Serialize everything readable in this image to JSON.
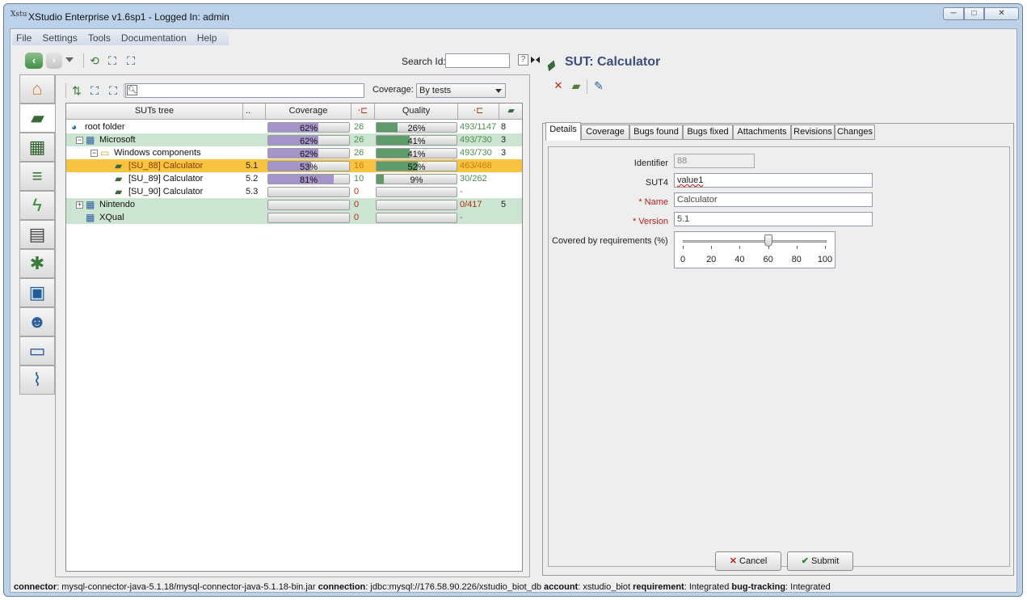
{
  "window": {
    "title": "XStudio Enterprise v1.6sp1 - Logged In: admin",
    "app_icon": "Xstu",
    "min": "─",
    "max": "□",
    "close": "✕"
  },
  "menu": [
    "File",
    "Settings",
    "Tools",
    "Documentation",
    "Help"
  ],
  "toolbar": {
    "search_label": "Search Id:",
    "search_value": "",
    "help": "?"
  },
  "left": {
    "filter_value": "",
    "coverage_label": "Coverage:",
    "coverage_option": "By tests",
    "columns": {
      "tree": "SUTs tree",
      "dots": "..",
      "coverage": "Coverage",
      "quality": "Quality"
    },
    "rows": [
      {
        "name": "root folder",
        "version": "",
        "cov": "62%",
        "cov_pct": 62,
        "cov_count": "26",
        "qual": "26%",
        "qual_pct": 26,
        "qual_count": "493/1147",
        "bugs": "8",
        "style": "plain",
        "depth": 0,
        "expander": "",
        "icon": "globe"
      },
      {
        "name": "Microsoft",
        "version": "",
        "cov": "62%",
        "cov_pct": 62,
        "cov_count": "26",
        "qual": "41%",
        "qual_pct": 41,
        "qual_count": "493/730",
        "bugs": "3",
        "style": "green",
        "depth": 1,
        "expander": "−",
        "icon": "company"
      },
      {
        "name": "Windows components",
        "version": "",
        "cov": "62%",
        "cov_pct": 62,
        "cov_count": "26",
        "qual": "41%",
        "qual_pct": 41,
        "qual_count": "493/730",
        "bugs": "3",
        "style": "plain",
        "depth": 2,
        "expander": "−",
        "icon": "folder"
      },
      {
        "name": "[SU_88] Calculator",
        "version": "5.1",
        "cov": "53%",
        "cov_pct": 53,
        "cov_count": "16",
        "qual": "52%",
        "qual_pct": 52,
        "qual_count": "463/468",
        "bugs": "",
        "style": "sel",
        "depth": 3,
        "expander": "",
        "icon": "sut"
      },
      {
        "name": "[SU_89] Calculator",
        "version": "5.2",
        "cov": "81%",
        "cov_pct": 81,
        "cov_count": "10",
        "qual": "9%",
        "qual_pct": 9,
        "qual_count": "30/262",
        "bugs": "",
        "style": "plain",
        "depth": 3,
        "expander": "",
        "icon": "sut"
      },
      {
        "name": "[SU_90] Calculator",
        "version": "5.3",
        "cov": "",
        "cov_pct": 0,
        "cov_count": "0",
        "qual": "",
        "qual_pct": 0,
        "qual_count": "-",
        "bugs": "",
        "style": "plain",
        "depth": 3,
        "expander": "",
        "icon": "sut"
      },
      {
        "name": "Nintendo",
        "version": "",
        "cov": "",
        "cov_pct": 0,
        "cov_count": "0",
        "qual": "",
        "qual_pct": 0,
        "qual_count": "0/417",
        "bugs": "5",
        "style": "green",
        "depth": 1,
        "expander": "+",
        "icon": "company"
      },
      {
        "name": "XQual",
        "version": "",
        "cov": "",
        "cov_pct": 0,
        "cov_count": "0",
        "qual": "",
        "qual_pct": 0,
        "qual_count": "-",
        "bugs": "",
        "style": "green",
        "depth": 1,
        "expander": "",
        "icon": "company2"
      }
    ]
  },
  "right": {
    "title": "SUT: Calculator",
    "tabs": [
      "Details",
      "Coverage",
      "Bugs found",
      "Bugs fixed",
      "Attachments",
      "Revisions",
      "Changes"
    ],
    "fields": {
      "identifier_label": "Identifier",
      "identifier_value": "88",
      "sut4_label": "SUT4",
      "sut4_value": "value1",
      "name_label": "Name",
      "name_value": "Calculator",
      "version_label": "Version",
      "version_value": "5.1",
      "required_mark": "*",
      "covered_label": "Covered by requirements (%)"
    },
    "slider": {
      "value": 60,
      "min": 0,
      "max": 100,
      "ticks": [
        "0",
        "20",
        "40",
        "60",
        "80",
        "100"
      ]
    },
    "cancel": "Cancel",
    "submit": "Submit"
  },
  "status": {
    "connector_label": "connector",
    "connector_value": ": mysql-connector-java-5.1.18/mysql-connector-java-5.1.18-bin.jar",
    "connection_label": "connection",
    "connection_value": ": jdbc:mysql://176.58.90.226/xstudio_biot_db",
    "account_label": "account",
    "account_value": ": xstudio_biot",
    "requirement_label": "requirement",
    "requirement_value": ": Integrated",
    "bugtracking_label": "bug-tracking",
    "bugtracking_value": ": Integrated"
  },
  "colors": {
    "coverage_fill": "#a594c9",
    "quality_fill": "#5f9a6a",
    "selected_row": "#f8c341",
    "green_row": "#cce4d2",
    "title_blue": "#3b4f7a"
  }
}
